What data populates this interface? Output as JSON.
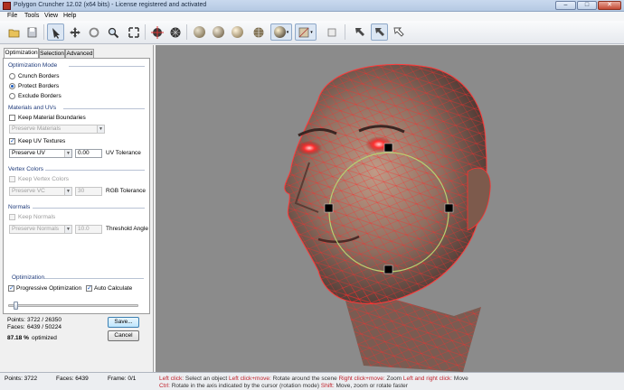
{
  "window": {
    "title": "Polygon Cruncher 12.02 (x64 bits) - License registered and activated",
    "minimize": "–",
    "maximize": "□",
    "close": "✕"
  },
  "menu": [
    "File",
    "Tools",
    "View",
    "Help"
  ],
  "tabs": [
    "Optimization",
    "Selection",
    "Advanced"
  ],
  "optimization_mode": {
    "title": "Optimization Mode",
    "options": [
      "Crunch Borders",
      "Protect Borders",
      "Exclude Borders"
    ],
    "selected": "Protect Borders"
  },
  "materials_uvs": {
    "title": "Materials and UVs",
    "keep_material_boundaries": "Keep Material Boundaries",
    "preserve_materials": "Preserve Materials",
    "keep_uv_textures": "Keep UV Textures",
    "preserve_uv": "Preserve UV",
    "uv_value": "0.00",
    "uv_tolerance": "UV Tolerance"
  },
  "vertex_colors": {
    "title": "Vertex Colors",
    "keep_vertex_colors": "Keep Vertex Colors",
    "preserve_vc": "Preserve VC",
    "rgb_value": "30",
    "rgb_tolerance": "RGB Tolerance"
  },
  "normals": {
    "title": "Normals",
    "keep_normals": "Keep Normals",
    "preserve_normals": "Preserve Normals",
    "threshold_value": "10.0",
    "threshold_angle": "Threshold Angle"
  },
  "optimization": {
    "title": "Optimization",
    "progressive": "Progressive Optimization",
    "auto_calculate": "Auto Calculate",
    "slider_fraction": 0.04,
    "points_label": "Points:",
    "points_value": "3722 / 26350",
    "faces_label": "Faces:",
    "faces_value": "6439 / 50224",
    "percent": "87.18 %",
    "percent_suffix": "optimized",
    "save": "Save...",
    "cancel": "Cancel"
  },
  "status": {
    "points": "Points: 3722",
    "faces": "Faces: 6439",
    "frame": "Frame: 0/1",
    "help_line1": [
      {
        "t": "Left click: ",
        "c": "accent"
      },
      {
        "t": "Select an object ",
        "c": "dark"
      },
      {
        "t": "Left click+move: ",
        "c": "accent"
      },
      {
        "t": "Rotate around the scene ",
        "c": "dark"
      },
      {
        "t": "Right click+move: ",
        "c": "accent"
      },
      {
        "t": "Zoom ",
        "c": "dark"
      },
      {
        "t": "Left and right click: ",
        "c": "accent"
      },
      {
        "t": "Move",
        "c": "dark"
      }
    ],
    "help_line2": [
      {
        "t": "Ctrl: ",
        "c": "accent"
      },
      {
        "t": "Rotate in the axis indicated by the cursor (rotation mode) ",
        "c": "dark"
      },
      {
        "t": "Shift: ",
        "c": "accent"
      },
      {
        "t": "Move, zoom or rotate faster",
        "c": "dark"
      }
    ]
  },
  "toolbar_icons": [
    "open-file-icon",
    "save-file-icon",
    "select-arrow-icon",
    "move-icon",
    "rotate-icon",
    "zoom-icon",
    "zoom-all-icon",
    "center-object-icon",
    "explode-view-icon",
    "shade-flat-sphere-icon",
    "shade-smooth-sphere-icon",
    "shade-gouraud-sphere-icon",
    "wireframe-sphere-icon",
    "textured-sphere-icon",
    "texture-display-icon",
    "background-icon",
    "arrow-nw-icon",
    "arrow-nw-active-icon",
    "arrow-nw-outline-icon"
  ],
  "colors": {
    "wire": "#ff2a2a",
    "gizmo_ring": "#b8d070",
    "viewport_bg": "#8b8b8b"
  }
}
